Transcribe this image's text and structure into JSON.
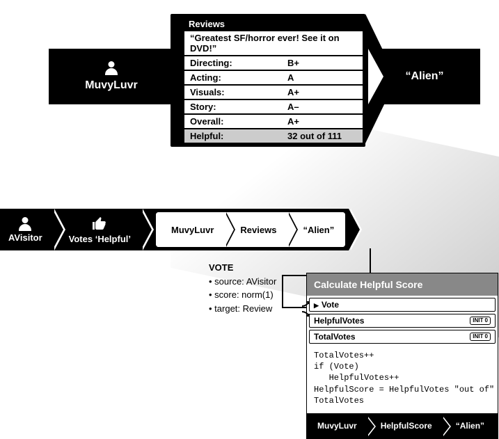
{
  "reviewer": {
    "name": "MuvyLuvr"
  },
  "target": {
    "title": "“Alien”"
  },
  "review": {
    "header": "Reviews",
    "quote": "“Greatest SF/horror ever! See it on DVD!”",
    "rows": [
      {
        "label": "Directing:",
        "value": "B+"
      },
      {
        "label": "Acting:",
        "value": "A"
      },
      {
        "label": "Visuals:",
        "value": "A+"
      },
      {
        "label": "Story:",
        "value": "A–"
      },
      {
        "label": "Overall:",
        "value": "A+"
      }
    ],
    "helpful": {
      "label": "Helpful:",
      "value": "32 out of 111"
    }
  },
  "chain": {
    "visitor": "AVisitor",
    "action": "Votes ‘Helpful’",
    "path": [
      "MuvyLuvr",
      "Reviews",
      "“Alien”"
    ]
  },
  "vote": {
    "title": "VOTE",
    "lines": [
      "• source: AVisitor",
      "• score: norm(1)",
      "• target: Review"
    ]
  },
  "calc": {
    "title": "Calculate Helpful Score",
    "rows": [
      {
        "label": "Vote",
        "arrow": true,
        "init": false
      },
      {
        "label": "HelpfulVotes",
        "arrow": false,
        "init": true
      },
      {
        "label": "TotalVotes",
        "arrow": false,
        "init": true
      }
    ],
    "init_label": "INIT\n0",
    "code": "TotalVotes++\nif (Vote)\n   HelpfulVotes++\nHelpfulScore = HelpfulVotes \"out of\"\nTotalVotes",
    "footer": [
      "MuvyLuvr",
      "HelpfulScore",
      "“Alien”"
    ]
  }
}
